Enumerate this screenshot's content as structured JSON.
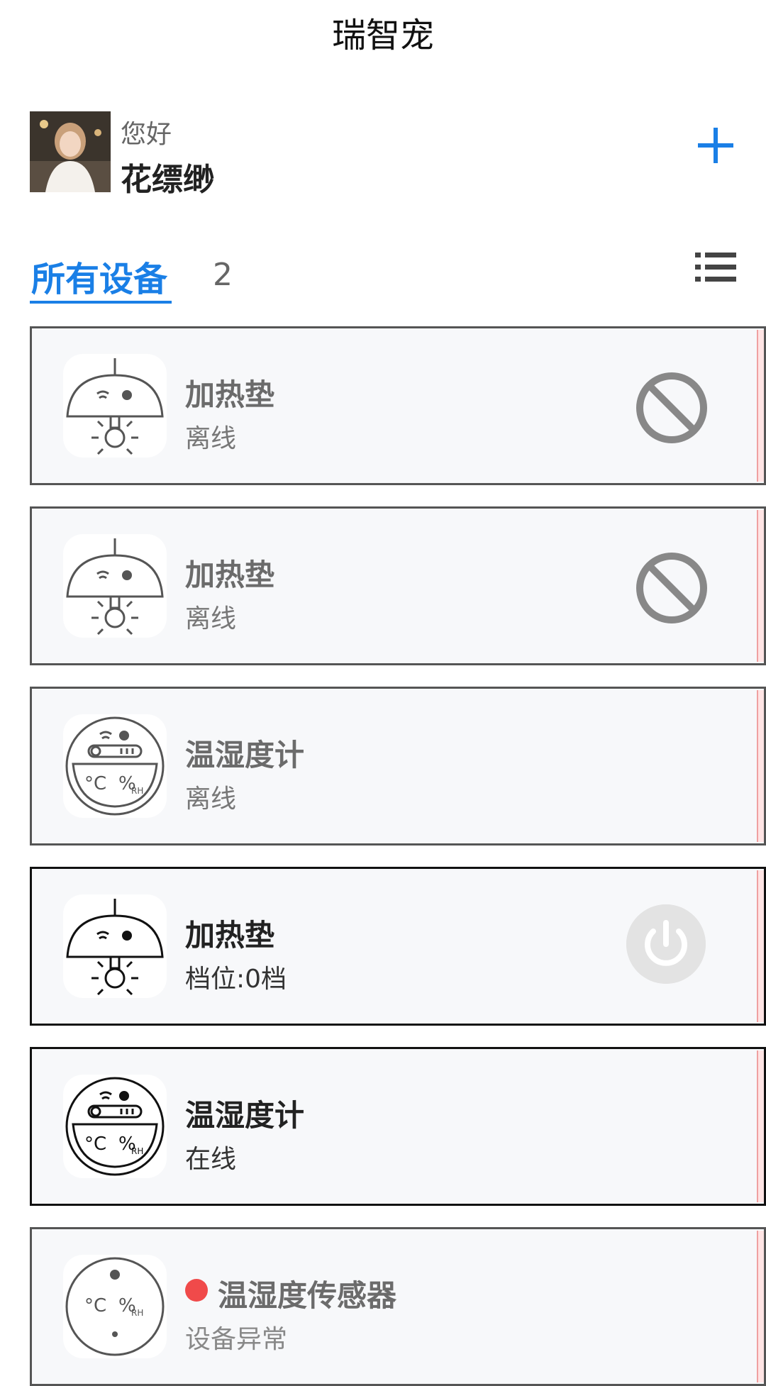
{
  "app": {
    "title": "瑞智宠"
  },
  "user": {
    "greeting": "您好",
    "name": "花缥缈"
  },
  "header": {
    "add_icon": "plus-icon",
    "list_icon": "list-icon"
  },
  "tabs": {
    "all_label": "所有设备",
    "count": "2"
  },
  "colors": {
    "accent": "#1a7fe6",
    "alert": "#f04a4a"
  },
  "devices": [
    {
      "name": "加热垫",
      "status": "离线",
      "kind": "heating-pad",
      "state": "offline",
      "action_icon": "disabled-icon"
    },
    {
      "name": "加热垫",
      "status": "离线",
      "kind": "heating-pad",
      "state": "offline",
      "action_icon": "disabled-icon"
    },
    {
      "name": "温湿度计",
      "status": "离线",
      "kind": "hygrometer",
      "state": "offline"
    },
    {
      "name": "加热垫",
      "status": "档位:0档",
      "kind": "heating-pad",
      "state": "online",
      "action_icon": "power-icon"
    },
    {
      "name": "温湿度计",
      "status": "在线",
      "kind": "hygrometer",
      "state": "online"
    },
    {
      "name": "温湿度传感器",
      "status": "设备异常",
      "kind": "sensor",
      "state": "alert"
    }
  ]
}
